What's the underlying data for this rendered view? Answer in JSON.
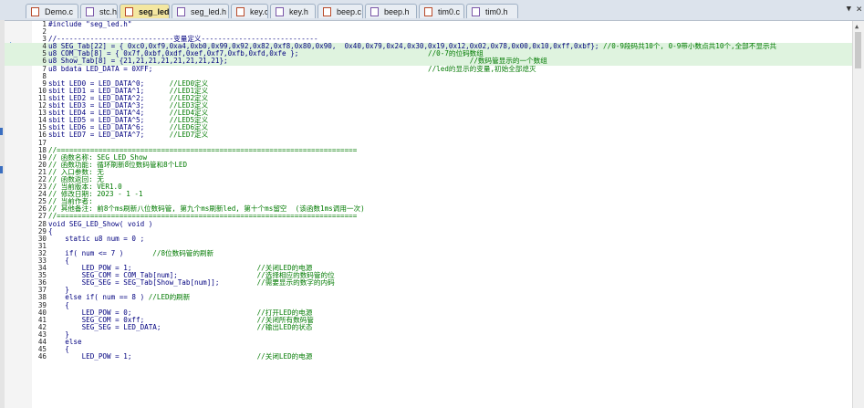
{
  "tabs": [
    {
      "label": "Demo.c",
      "type": "c"
    },
    {
      "label": "stc.h",
      "type": "h"
    },
    {
      "label": "seg_led.c",
      "type": "c"
    },
    {
      "label": "seg_led.h",
      "type": "h"
    },
    {
      "label": "key.c",
      "type": "c"
    },
    {
      "label": "key.h",
      "type": "h"
    },
    {
      "label": "beep.c",
      "type": "c"
    },
    {
      "label": "beep.h",
      "type": "h"
    },
    {
      "label": "tim0.c",
      "type": "c"
    },
    {
      "label": "tim0.h",
      "type": "h"
    }
  ],
  "active_tab_index": 2,
  "highlighted_lines": [
    4,
    5,
    6
  ],
  "lines": [
    {
      "n": "1",
      "code": "#include \"seg_led.h\"",
      "cmt": ""
    },
    {
      "n": "2",
      "code": "",
      "cmt": ""
    },
    {
      "n": "3",
      "code": "//----------------------------变量定义----------------------------",
      "cmt": ""
    },
    {
      "n": "4",
      "code": "u8 SEG_Tab[22] = { 0xc0,0xf9,0xa4,0xb0,0x99,0x92,0x82,0xf8,0x80,0x90,  0x40,0x79,0x24,0x30,0x19,0x12,0x02,0x78,0x00,0x10,0xff,0xbf};",
      "cmt": " //0-9段码共10个, 0-9带小数点共10个,全部不显示共"
    },
    {
      "n": "5",
      "code": "u8 COM_Tab[8] = { 0x7f,0xbf,0xdf,0xef,0xf7,0xfb,0xfd,0xfe };",
      "cmt": "                               //0-7的位码数组"
    },
    {
      "n": "6",
      "code": "u8 Show_Tab[8] = {21,21,21,21,21,21,21,21};",
      "cmt": "                                                          //数码管显示的一个数组"
    },
    {
      "n": "7",
      "code": "u8 bdata LED_DATA = 0XFF;",
      "cmt": "                                                                  //led的显示的变量,初始全部熄灭"
    },
    {
      "n": "8",
      "code": "",
      "cmt": ""
    },
    {
      "n": "9",
      "code": "sbit LED0 = LED_DATA^0;",
      "cmt": "      //LED0定义"
    },
    {
      "n": "10",
      "code": "sbit LED1 = LED_DATA^1;",
      "cmt": "      //LED1定义"
    },
    {
      "n": "11",
      "code": "sbit LED2 = LED_DATA^2;",
      "cmt": "      //LED2定义"
    },
    {
      "n": "12",
      "code": "sbit LED3 = LED_DATA^3;",
      "cmt": "      //LED3定义"
    },
    {
      "n": "13",
      "code": "sbit LED4 = LED_DATA^4;",
      "cmt": "      //LED4定义"
    },
    {
      "n": "14",
      "code": "sbit LED5 = LED_DATA^5;",
      "cmt": "      //LED5定义"
    },
    {
      "n": "15",
      "code": "sbit LED6 = LED_DATA^6;",
      "cmt": "      //LED6定义"
    },
    {
      "n": "16",
      "code": "sbit LED7 = LED_DATA^7;",
      "cmt": "      //LED7定义"
    },
    {
      "n": "17",
      "code": "",
      "cmt": ""
    },
    {
      "n": "18",
      "code": "",
      "cmt": "//========================================================================"
    },
    {
      "n": "19",
      "code": "",
      "cmt": "// 函数名称: SEG_LED_Show"
    },
    {
      "n": "20",
      "code": "",
      "cmt": "// 函数功能: 循环刷新8位数码管和8个LED"
    },
    {
      "n": "21",
      "code": "",
      "cmt": "// 入口参数: 无"
    },
    {
      "n": "22",
      "code": "",
      "cmt": "// 函数返回: 无"
    },
    {
      "n": "23",
      "code": "",
      "cmt": "// 当前版本: VER1.0"
    },
    {
      "n": "24",
      "code": "",
      "cmt": "// 修改日期: 2023 - 1 -1"
    },
    {
      "n": "25",
      "code": "",
      "cmt": "// 当前作者:"
    },
    {
      "n": "26",
      "code": "",
      "cmt": "// 其他备注: 前8个ms刷新八位数码管, 第九个ms刷新led, 第十个ms留空  (该函数1ms调用一次)"
    },
    {
      "n": "27",
      "code": "",
      "cmt": "//========================================================================"
    },
    {
      "n": "28",
      "code": "void SEG_LED_Show( void )",
      "cmt": ""
    },
    {
      "n": "29",
      "code": "{",
      "cmt": ""
    },
    {
      "n": "30",
      "code": "    static u8 num = 0 ;",
      "cmt": ""
    },
    {
      "n": "31",
      "code": "",
      "cmt": ""
    },
    {
      "n": "32",
      "code": "    if( num <= 7 )",
      "cmt": "       //8位数码管的刷新"
    },
    {
      "n": "33",
      "code": "    {",
      "cmt": ""
    },
    {
      "n": "34",
      "code": "        LED_POW = 1;",
      "cmt": "                              //关闭LED的电源"
    },
    {
      "n": "35",
      "code": "        SEG_COM = COM_Tab[num];",
      "cmt": "                   //选择相应的数码管的位"
    },
    {
      "n": "36",
      "code": "        SEG_SEG = SEG_Tab[Show_Tab[num]];",
      "cmt": "         //需要显示的数字的内码"
    },
    {
      "n": "37",
      "code": "    }",
      "cmt": ""
    },
    {
      "n": "38",
      "code": "    else if( num == 8 )",
      "cmt": " //LED的刷新"
    },
    {
      "n": "39",
      "code": "    {",
      "cmt": ""
    },
    {
      "n": "40",
      "code": "        LED_POW = 0;",
      "cmt": "                              //打开LED的电源"
    },
    {
      "n": "41",
      "code": "        SEG_COM = 0xff;",
      "cmt": "                           //关闭所有数码管"
    },
    {
      "n": "42",
      "code": "        SEG_SEG = LED_DATA;",
      "cmt": "                       //输出LED的状态"
    },
    {
      "n": "43",
      "code": "    }",
      "cmt": ""
    },
    {
      "n": "44",
      "code": "    else",
      "cmt": ""
    },
    {
      "n": "45",
      "code": "    {",
      "cmt": ""
    },
    {
      "n": "46",
      "code": "        LED_POW = 1;",
      "cmt": "                              //关闭LED的电源"
    }
  ],
  "colors": {
    "tab_active": "#f4e7a0",
    "tab_inactive": "#e8edf3",
    "keyword": "#00007f",
    "comment": "#007a00",
    "highlight": "#dff3df"
  }
}
